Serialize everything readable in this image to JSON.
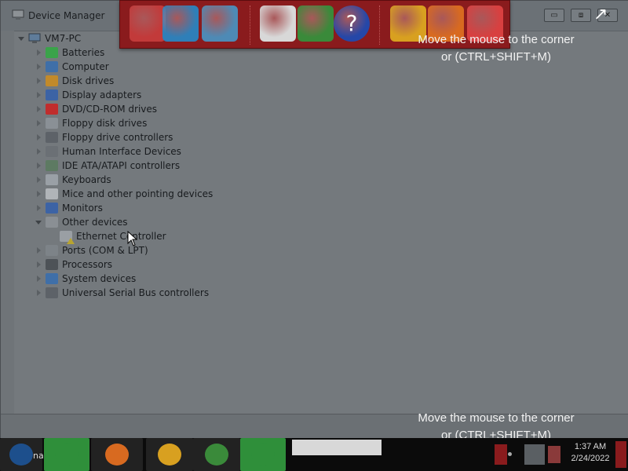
{
  "window": {
    "title": "Device Manager",
    "icon": "device-manager-icon",
    "buttons": {
      "minimize": "▭",
      "maximize": "⧈",
      "close": "✕"
    }
  },
  "tree": {
    "root": "VM7-PC",
    "items": [
      {
        "label": "Batteries",
        "icon": "battery-icon",
        "color": "#3aa34a"
      },
      {
        "label": "Computer",
        "icon": "computer-icon",
        "color": "#3f6fa8"
      },
      {
        "label": "Disk drives",
        "icon": "disk-drive-icon",
        "color": "#c28a2a"
      },
      {
        "label": "Display adapters",
        "icon": "display-adapter-icon",
        "color": "#3c63a5"
      },
      {
        "label": "DVD/CD-ROM drives",
        "icon": "dvd-icon",
        "color": "#c02d2d"
      },
      {
        "label": "Floppy disk drives",
        "icon": "floppy-disk-icon",
        "color": "#8a9096"
      },
      {
        "label": "Floppy drive controllers",
        "icon": "floppy-controller-icon",
        "color": "#5d6268"
      },
      {
        "label": "Human Interface Devices",
        "icon": "hid-icon",
        "color": "#6b7075"
      },
      {
        "label": "IDE ATA/ATAPI controllers",
        "icon": "ide-controller-icon",
        "color": "#5d7a62"
      },
      {
        "label": "Keyboards",
        "icon": "keyboard-icon",
        "color": "#9aa0a6"
      },
      {
        "label": "Mice and other pointing devices",
        "icon": "mouse-icon",
        "color": "#b0b4b8"
      },
      {
        "label": "Monitors",
        "icon": "monitor-icon",
        "color": "#3c63a5"
      },
      {
        "label": "Other devices",
        "icon": "other-devices-icon",
        "color": "#8a8f94",
        "expanded": true
      },
      {
        "label": "Ethernet Controller",
        "icon": "ethernet-warning-icon",
        "color": "#9a9fa4",
        "child": true
      },
      {
        "label": "Ports (COM & LPT)",
        "icon": "ports-icon",
        "color": "#7d8388"
      },
      {
        "label": "Processors",
        "icon": "processor-icon",
        "color": "#4d5257"
      },
      {
        "label": "System devices",
        "icon": "system-devices-icon",
        "color": "#3f6fa8"
      },
      {
        "label": "Universal Serial Bus controllers",
        "icon": "usb-icon",
        "color": "#5d6268"
      }
    ]
  },
  "dock": {
    "items": [
      {
        "icon": "santa-computer-icon",
        "color": "#c23a3a"
      },
      {
        "icon": "globe-network-icon",
        "color": "#2f7fb8"
      },
      {
        "icon": "control-panel-icon",
        "color": "#4e8ab5"
      },
      {
        "icon": "snowman-icon",
        "color": "#d8d8d8"
      },
      {
        "icon": "windows-logo-icon",
        "color": "#3a8a3a"
      },
      {
        "icon": "help-icon",
        "color": "#2547a8"
      },
      {
        "icon": "gift-box-icon",
        "color": "#d8a020"
      },
      {
        "icon": "folder-icon",
        "color": "#d86a20"
      },
      {
        "icon": "recycle-bin-icon",
        "color": "#d84040"
      }
    ]
  },
  "hints": {
    "top_line1": "Move the mouse to the corner",
    "top_line2": "or (CTRL+SHIFT+M)",
    "bottom_line1": "Move the mouse to the corner",
    "bottom_line2": "or (CTRL+SHIFT+M)"
  },
  "taskbar": {
    "start_partial_label": "na",
    "clock_time": "1:37 AM",
    "clock_date": "2/24/2022",
    "apps": [
      {
        "icon": "start-santa-icon",
        "color": "#1d4f8c"
      },
      {
        "icon": "internet-explorer-icon",
        "color": "#2f8f3a"
      },
      {
        "icon": "folder-explorer-icon",
        "color": "#d86a20"
      },
      {
        "icon": "media-player-icon",
        "color": "#d8a020"
      },
      {
        "icon": "chrome-icon",
        "color": "#3a8a3a"
      },
      {
        "icon": "toolbox-icon",
        "color": "#2f8f3a"
      }
    ]
  }
}
